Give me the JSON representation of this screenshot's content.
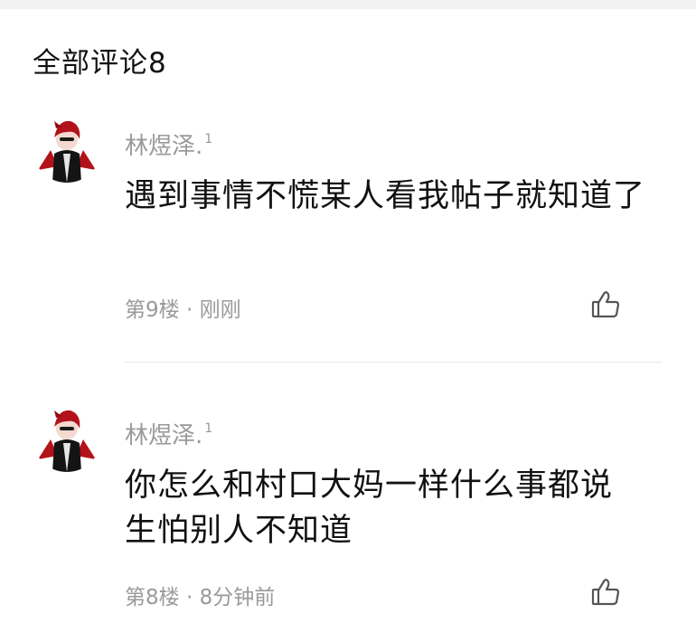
{
  "header": {
    "title": "全部评论8"
  },
  "comments": [
    {
      "username": "林煜泽.",
      "badge": "1",
      "text": "遇到事情不慌某人看我帖子就知道了",
      "floor": "第9楼",
      "separator": "·",
      "time": "刚刚",
      "like_icon": "thumbs-up-icon"
    },
    {
      "username": "林煜泽.",
      "badge": "1",
      "text": "你怎么和村口大妈一样什么事都说 生怕别人不知道",
      "floor": "第8楼",
      "separator": "·",
      "time": "8分钟前",
      "like_icon": "thumbs-up-icon"
    }
  ],
  "colors": {
    "username": "#9a9a9a",
    "text": "#111111",
    "divider": "#e8e8e8",
    "avatar_accent": "#b3121a"
  }
}
